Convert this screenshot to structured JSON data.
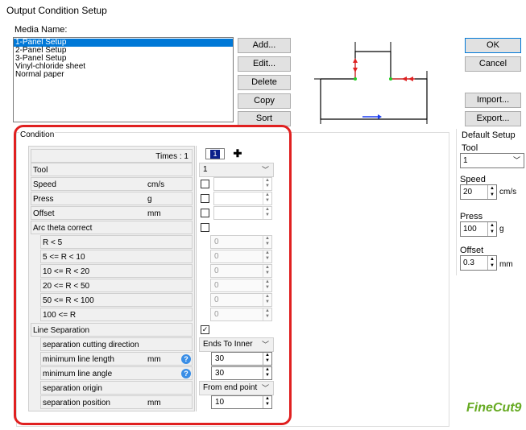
{
  "window": {
    "title": "Output Condition Setup"
  },
  "media": {
    "label": "Media Name:",
    "items": [
      "1-Panel Setup",
      "2-Panel Setup",
      "3-Panel Setup",
      "Vinyl-chloride sheet",
      "Normal paper"
    ],
    "selected_index": 0
  },
  "buttons": {
    "add": "Add...",
    "edit": "Edit...",
    "delete": "Delete",
    "copy": "Copy",
    "sort": "Sort",
    "ok": "OK",
    "cancel": "Cancel",
    "import": "Import...",
    "export": "Export..."
  },
  "condition": {
    "title": "Condition",
    "times_label": "Times : 1",
    "times_value": "1",
    "rows": {
      "tool": "Tool",
      "speed": "Speed",
      "speed_unit": "cm/s",
      "press": "Press",
      "press_unit": "g",
      "offset": "Offset",
      "offset_unit": "mm",
      "arc": "Arc theta correct",
      "r1": "R < 5",
      "r2": "5 <= R < 10",
      "r3": "10 <= R < 20",
      "r4": "20 <= R < 50",
      "r5": "50 <= R < 100",
      "r6": "100 <= R",
      "line_sep": "Line Separation",
      "sep_dir": "separation cutting direction",
      "min_len": "minimum line length",
      "min_len_unit": "mm",
      "min_ang": "minimum line angle",
      "sep_origin": "separation origin",
      "sep_pos": "separation position",
      "sep_pos_unit": "mm"
    },
    "values": {
      "tool": "1",
      "r1": "0",
      "r2": "0",
      "r3": "0",
      "r4": "0",
      "r5": "0",
      "r6": "0",
      "sep_dir": "Ends To Inner",
      "min_len": "30",
      "min_ang": "30",
      "sep_origin": "From end point",
      "sep_pos": "10"
    },
    "help_glyph": "?"
  },
  "default_setup": {
    "title": "Default Setup",
    "tool_label": "Tool",
    "tool_value": "1",
    "speed_label": "Speed",
    "speed_value": "20",
    "speed_unit": "cm/s",
    "press_label": "Press",
    "press_value": "100",
    "press_unit": "g",
    "offset_label": "Offset",
    "offset_value": "0.3",
    "offset_unit": "mm"
  },
  "logo": {
    "text": "FineCut9",
    "color": "#66aa22"
  },
  "colors": {
    "accent": "#0078d7",
    "highlight": "#e02020",
    "arrow_blue": "#1a3cf0"
  }
}
